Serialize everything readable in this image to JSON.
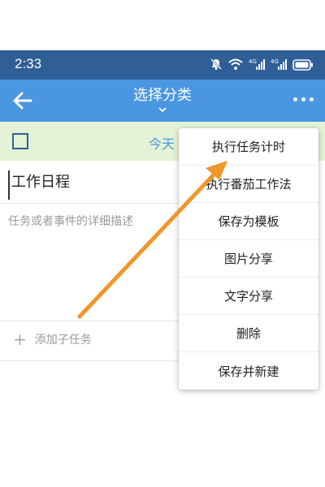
{
  "status_bar": {
    "time": "2:33",
    "icons": [
      "mute-icon",
      "wifi-icon",
      "signal-4g-icon",
      "signal-4g-icon",
      "battery-icon"
    ],
    "background": "#2f5f96"
  },
  "app_bar": {
    "title": "选择分类",
    "back_icon": "arrow-left-icon",
    "more_icon": "more-horizontal-icon",
    "background": "#4a96e0"
  },
  "date_bar": {
    "date_label": "今天",
    "background": "#e4f3d6"
  },
  "editor": {
    "title_value": "工作日程",
    "description_placeholder": "任务或者事件的详细描述",
    "add_subtask_label": "添加子任务"
  },
  "menu": {
    "items": [
      "执行任务计时",
      "执行番茄工作法",
      "保存为模板",
      "图片分享",
      "文字分享",
      "删除",
      "保存并新建"
    ]
  },
  "annotation": {
    "arrow_color": "#f0962a"
  }
}
